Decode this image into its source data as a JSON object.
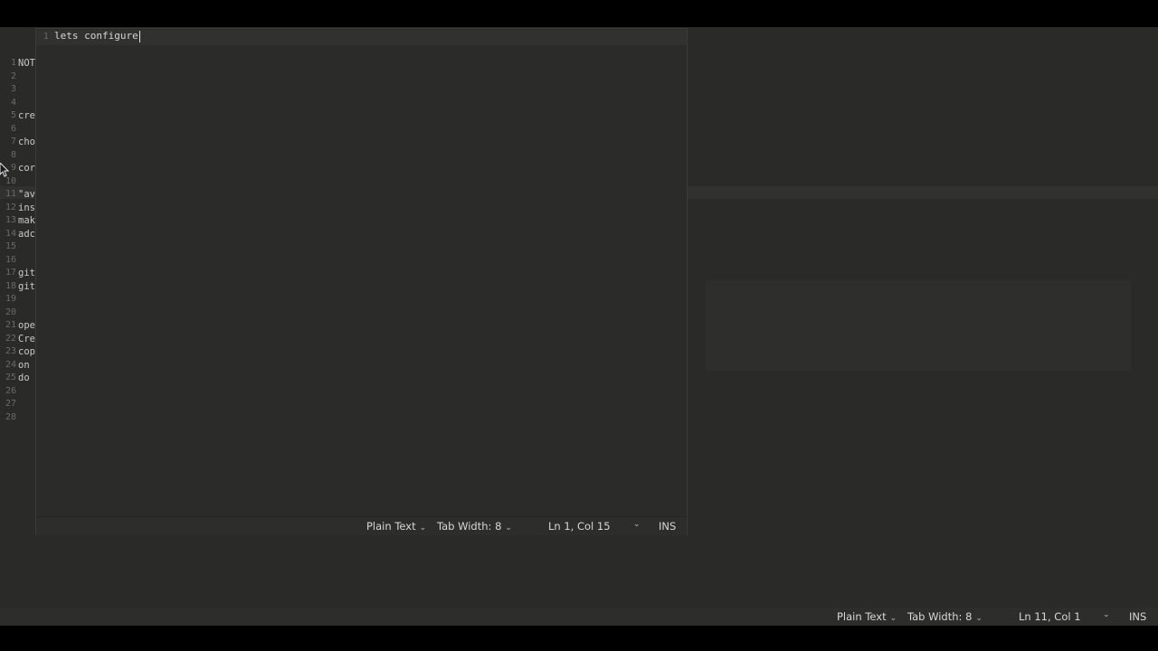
{
  "background_editor": {
    "line_numbers": [
      "1",
      "2",
      "3",
      "4",
      "5",
      "6",
      "7",
      "8",
      "9",
      "10",
      "11",
      "12",
      "13",
      "14",
      "15",
      "16",
      "17",
      "18",
      "19",
      "20",
      "21",
      "22",
      "23",
      "24",
      "25",
      "26",
      "27",
      "28"
    ],
    "lines": [
      "NOT",
      "",
      "",
      "",
      "cre",
      "",
      "cho",
      "",
      "cor",
      "",
      "\"av",
      "ins",
      "mak",
      "adc",
      "",
      "",
      "git",
      "git",
      "",
      "",
      "ope",
      "Cre",
      "cop",
      "on",
      "do",
      "",
      "",
      ""
    ],
    "status": {
      "language": "Plain Text",
      "tab_width": "Tab Width: 8",
      "position": "Ln 11, Col 1",
      "mode": "INS"
    }
  },
  "foreground_editor": {
    "line_number": "1",
    "text": "lets configure",
    "status": {
      "language": "Plain Text",
      "tab_width": "Tab Width: 8",
      "position": "Ln 1, Col 15",
      "mode": "INS"
    }
  },
  "icons": {
    "dropdown": "chevron-down-icon",
    "pointer": "mouse-pointer-icon"
  }
}
